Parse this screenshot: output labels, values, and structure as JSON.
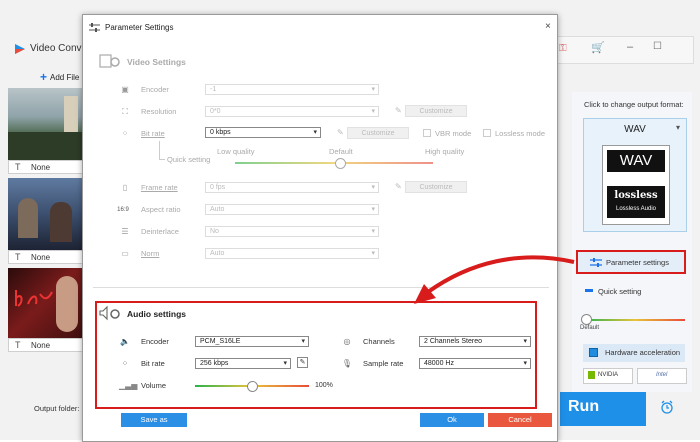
{
  "app": {
    "title": "Video Conv",
    "add_file": "Add File",
    "output_folder": "Output folder:",
    "thumbs": [
      {
        "label": "None"
      },
      {
        "label": "None"
      },
      {
        "label": "None"
      }
    ],
    "right": {
      "click_change": "Click to change output format:",
      "format": "WAV",
      "logo_top": "WAV",
      "logo_mid": "lossless",
      "logo_sub": "Lossless Audio",
      "parameter_settings": "Parameter settings",
      "quick_setting": "Quick setting",
      "default": "Default",
      "hw_accel": "Hardware acceleration",
      "nvidia": "NVIDIA",
      "intel": "Intel",
      "run": "Run"
    }
  },
  "dialog": {
    "title": "Parameter Settings",
    "close": "×",
    "video": {
      "heading": "Video Settings",
      "encoder_label": "Encoder",
      "encoder_value": "-1",
      "resolution_label": "Resolution",
      "resolution_value": "0*0",
      "resolution_customize": "Customize",
      "bitrate_label": "Bit rate",
      "bitrate_value": "0 kbps",
      "bitrate_customize": "Customize",
      "vbr": "VBR mode",
      "lossless": "Lossless mode",
      "quick_setting": "Quick setting",
      "q_low": "Low quality",
      "q_default": "Default",
      "q_high": "High quality",
      "framerate_label": "Frame rate",
      "framerate_value": "0 fps",
      "framerate_customize": "Customize",
      "aspect_label": "Aspect ratio",
      "aspect_value": "Auto",
      "deinterlace_label": "Deinterlace",
      "deinterlace_value": "No",
      "norm_label": "Norm",
      "norm_value": "Auto"
    },
    "audio": {
      "heading": "Audio settings",
      "encoder_label": "Encoder",
      "encoder_value": "PCM_S16LE",
      "channels_label": "Channels",
      "channels_value": "2 Channels Stereo",
      "bitrate_label": "Bit rate",
      "bitrate_value": "256 kbps",
      "samplerate_label": "Sample rate",
      "samplerate_value": "48000 Hz",
      "volume_label": "Volume",
      "volume_value": "100%",
      "volume_level": 0.5
    },
    "buttons": {
      "save_as": "Save as",
      "ok": "Ok",
      "cancel": "Cancel"
    }
  },
  "colors": {
    "accent": "#1e90e8",
    "highlight": "#d81c1c",
    "cancel": "#e9583e"
  }
}
